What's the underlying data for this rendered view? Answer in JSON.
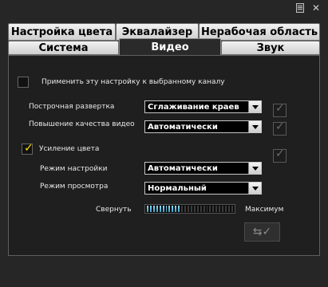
{
  "tabs_row1": [
    {
      "label": "Настройка цвета"
    },
    {
      "label": "Эквалайзер"
    },
    {
      "label": "Нерабочая область"
    }
  ],
  "tabs_row2": [
    {
      "label": "Система"
    },
    {
      "label": "Видео",
      "active": true
    },
    {
      "label": "Звук"
    }
  ],
  "apply_channel": {
    "label": "Применить эту настройку к выбранному каналу",
    "checked": false
  },
  "deinterlace": {
    "label": "Построчная развертка",
    "value": "Сглаживание краев",
    "enabled": true
  },
  "enhance_video": {
    "label": "Повышение качества видео",
    "value": "Автоматически",
    "enabled": true
  },
  "color_boost": {
    "label": "Усиление цвета",
    "checked": true
  },
  "tuning_mode": {
    "label": "Режим настройки",
    "value": "Автоматически"
  },
  "view_mode": {
    "label": "Режим просмотра",
    "value": "Нормальный"
  },
  "meter": {
    "min_label": "Свернуть",
    "max_label": "Максимум",
    "level_segments": 11,
    "total_segments": 28
  },
  "colors": {
    "accent": "#ffe100",
    "meter_on": "#6cc6e6"
  },
  "icons": {
    "doc": "document-icon",
    "close": "close-icon",
    "apply": "apply-icon"
  }
}
